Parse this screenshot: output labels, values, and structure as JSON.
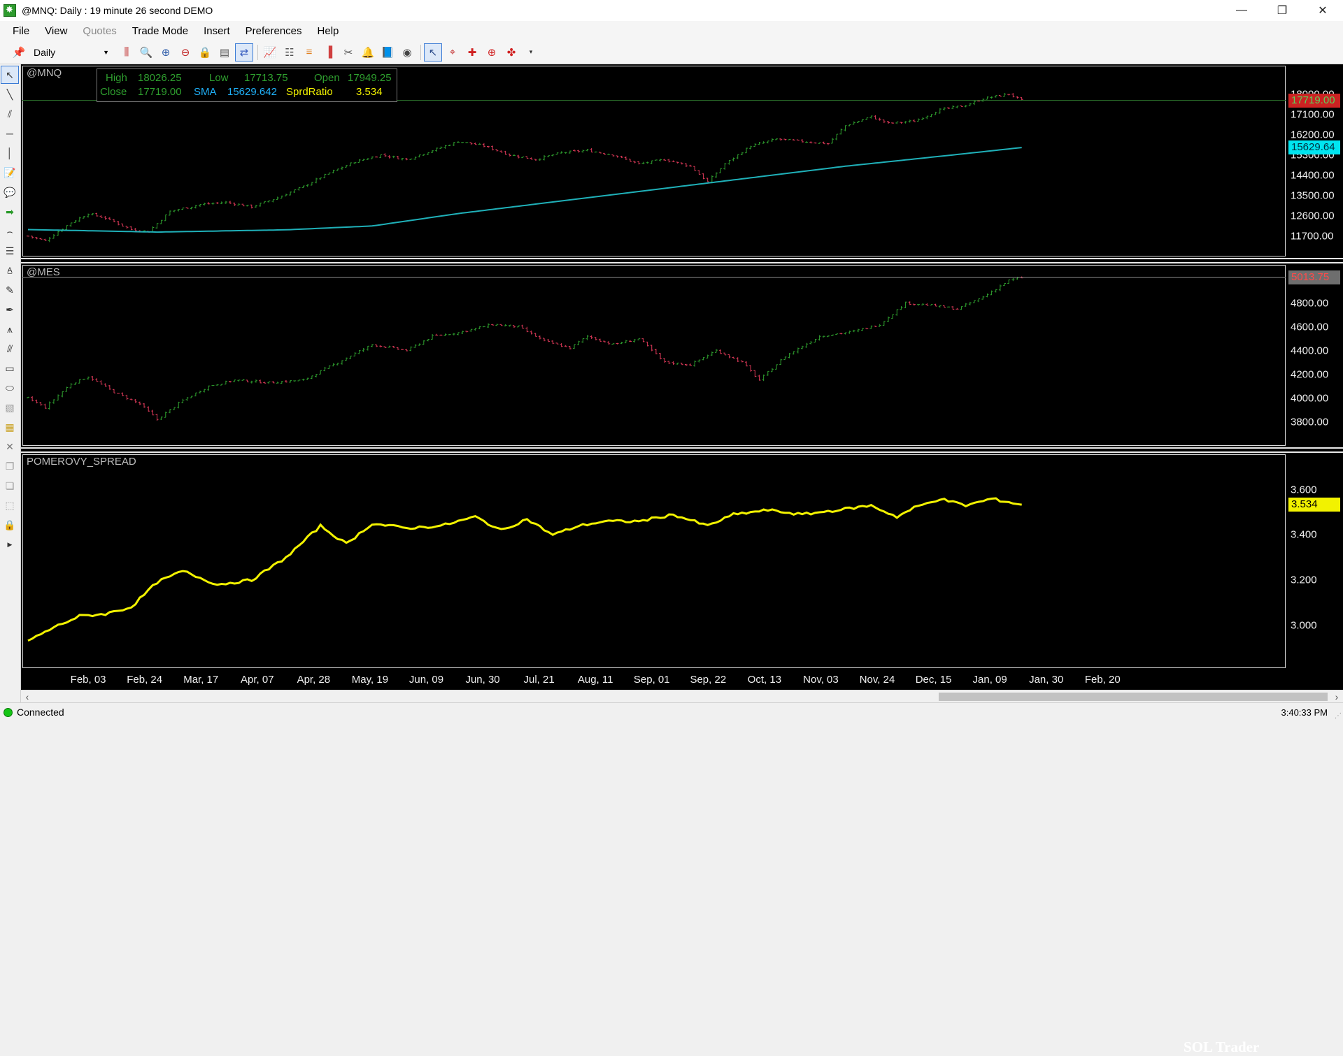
{
  "window": {
    "title": "@MNQ: Daily : 19 minute 26 second DEMO",
    "minimize_icon": "minimize-icon",
    "restore_icon": "restore-icon",
    "close_icon": "close-icon"
  },
  "menu": {
    "file": "File",
    "view": "View",
    "quotes": "Quotes",
    "trade_mode": "Trade Mode",
    "insert": "Insert",
    "preferences": "Preferences",
    "help": "Help"
  },
  "toolbar": {
    "interval": "Daily",
    "icons": [
      "pushpin-icon",
      "bar-style-icon",
      "zoom-menu-icon",
      "zoom-in-icon",
      "zoom-out-icon",
      "lock-icon",
      "page-icon",
      "link-icon",
      "indicator-icon",
      "tree-icon",
      "color-bars-icon",
      "volume-bars-icon",
      "scissors-icon",
      "alert-bell-icon",
      "book-icon",
      "eye-icon",
      "pointer-icon",
      "crosshair-icon",
      "cross-icon",
      "target-icon",
      "overflow-icon"
    ]
  },
  "lefttools": [
    "pointer-icon",
    "line-icon",
    "parallel-lines-icon",
    "horizontal-line-icon",
    "vertical-line-icon",
    "note-icon",
    "callout-icon",
    "arrow-icon",
    "arc-icon",
    "fibonacci-icon",
    "text-icon",
    "pencil-icon",
    "pen-icon",
    "pitchfork-icon",
    "gann-icon",
    "rectangle-icon",
    "ellipse-icon",
    "eraser-icon",
    "calendar-icon",
    "delete-icon",
    "copy-icon",
    "paste-icon",
    "select-icon",
    "padlock-icon",
    "expand-icon"
  ],
  "infobox": {
    "high_label": "High",
    "high_value": "18026.25",
    "low_label": "Low",
    "low_value": "17713.75",
    "open_label": "Open",
    "open_value": "17949.25",
    "close_label": "Close",
    "close_value": "17719.00",
    "sma_label": "SMA",
    "sma_value": "15629.642",
    "ratio_label": "SprdRatio",
    "ratio_value": "3.534"
  },
  "colors": {
    "up_bar": "#2fa02f",
    "down_bar": "#e03a5a",
    "sma_line": "#1fb0b8",
    "spread_line": "#f2f200",
    "last_price_mnq": "#cc2222",
    "last_price_mes": "#ff4a4a",
    "sma_tag_bg": "#00e5f0"
  },
  "chart_data": [
    {
      "type": "candlestick",
      "title": "@MNQ",
      "y_ticks": [
        "18000.00",
        "17100.00",
        "16200.00",
        "15300.00",
        "14400.00",
        "13500.00",
        "12600.00",
        "11700.00"
      ],
      "ylim": [
        11200,
        18700
      ],
      "last_price": 17719.0,
      "last_price_label": "17719.00",
      "sma_value": 15629.64,
      "sma_label": "15629.64",
      "close_path": [
        [
          0,
          11700
        ],
        [
          4,
          11500
        ],
        [
          10,
          12300
        ],
        [
          14,
          12700
        ],
        [
          18,
          12500
        ],
        [
          24,
          12000
        ],
        [
          28,
          11900
        ],
        [
          33,
          12800
        ],
        [
          40,
          13100
        ],
        [
          46,
          13200
        ],
        [
          52,
          13000
        ],
        [
          58,
          13400
        ],
        [
          64,
          13900
        ],
        [
          70,
          14500
        ],
        [
          76,
          15000
        ],
        [
          82,
          15300
        ],
        [
          88,
          15100
        ],
        [
          94,
          15500
        ],
        [
          100,
          15900
        ],
        [
          106,
          15700
        ],
        [
          112,
          15300
        ],
        [
          118,
          15100
        ],
        [
          124,
          15400
        ],
        [
          130,
          15500
        ],
        [
          136,
          15300
        ],
        [
          142,
          14900
        ],
        [
          148,
          15100
        ],
        [
          154,
          14800
        ],
        [
          158,
          14100
        ],
        [
          162,
          14900
        ],
        [
          168,
          15700
        ],
        [
          174,
          16000
        ],
        [
          180,
          15900
        ],
        [
          186,
          15800
        ],
        [
          190,
          16600
        ],
        [
          196,
          17000
        ],
        [
          200,
          16700
        ],
        [
          206,
          16800
        ],
        [
          212,
          17300
        ],
        [
          218,
          17500
        ],
        [
          222,
          17800
        ],
        [
          228,
          18000
        ],
        [
          231,
          17719
        ]
      ],
      "sma_path": [
        [
          0,
          11990
        ],
        [
          30,
          11880
        ],
        [
          60,
          11980
        ],
        [
          80,
          12150
        ],
        [
          100,
          12700
        ],
        [
          130,
          13400
        ],
        [
          160,
          14100
        ],
        [
          190,
          14800
        ],
        [
          215,
          15300
        ],
        [
          231,
          15629.64
        ]
      ]
    },
    {
      "type": "candlestick",
      "title": "@MES",
      "y_ticks": [
        "4800.00",
        "4600.00",
        "4400.00",
        "4200.00",
        "4000.00",
        "3800.00"
      ],
      "ylim": [
        3650,
        5050
      ],
      "last_price": 5013.75,
      "last_price_label": "5013.75",
      "close_path": [
        [
          0,
          4000
        ],
        [
          4,
          3920
        ],
        [
          10,
          4120
        ],
        [
          14,
          4180
        ],
        [
          20,
          4050
        ],
        [
          26,
          3950
        ],
        [
          30,
          3820
        ],
        [
          36,
          3980
        ],
        [
          42,
          4100
        ],
        [
          48,
          4150
        ],
        [
          56,
          4130
        ],
        [
          64,
          4150
        ],
        [
          72,
          4300
        ],
        [
          80,
          4450
        ],
        [
          88,
          4400
        ],
        [
          94,
          4520
        ],
        [
          100,
          4550
        ],
        [
          108,
          4620
        ],
        [
          114,
          4600
        ],
        [
          120,
          4480
        ],
        [
          126,
          4420
        ],
        [
          130,
          4520
        ],
        [
          136,
          4450
        ],
        [
          142,
          4500
        ],
        [
          148,
          4300
        ],
        [
          154,
          4280
        ],
        [
          160,
          4400
        ],
        [
          166,
          4300
        ],
        [
          170,
          4150
        ],
        [
          176,
          4350
        ],
        [
          184,
          4520
        ],
        [
          192,
          4560
        ],
        [
          198,
          4620
        ],
        [
          204,
          4800
        ],
        [
          210,
          4780
        ],
        [
          216,
          4750
        ],
        [
          222,
          4850
        ],
        [
          228,
          4990
        ],
        [
          231,
          5013.75
        ]
      ]
    },
    {
      "type": "line",
      "title": "POMEROVY_SPREAD",
      "y_ticks": [
        "3.600",
        "3.400",
        "3.200",
        "3.000"
      ],
      "ylim": [
        2.85,
        3.72
      ],
      "last_value": 3.534,
      "last_value_label": "3.534",
      "path": [
        [
          0,
          2.93
        ],
        [
          6,
          2.99
        ],
        [
          12,
          3.04
        ],
        [
          18,
          3.05
        ],
        [
          24,
          3.08
        ],
        [
          30,
          3.19
        ],
        [
          36,
          3.24
        ],
        [
          44,
          3.18
        ],
        [
          52,
          3.2
        ],
        [
          60,
          3.3
        ],
        [
          68,
          3.44
        ],
        [
          74,
          3.36
        ],
        [
          80,
          3.45
        ],
        [
          88,
          3.43
        ],
        [
          96,
          3.44
        ],
        [
          104,
          3.48
        ],
        [
          110,
          3.42
        ],
        [
          116,
          3.47
        ],
        [
          122,
          3.4
        ],
        [
          128,
          3.44
        ],
        [
          134,
          3.46
        ],
        [
          142,
          3.46
        ],
        [
          150,
          3.49
        ],
        [
          158,
          3.44
        ],
        [
          164,
          3.49
        ],
        [
          172,
          3.51
        ],
        [
          180,
          3.49
        ],
        [
          188,
          3.51
        ],
        [
          196,
          3.53
        ],
        [
          202,
          3.48
        ],
        [
          206,
          3.52
        ],
        [
          212,
          3.56
        ],
        [
          218,
          3.53
        ],
        [
          224,
          3.56
        ],
        [
          231,
          3.534
        ]
      ]
    }
  ],
  "x_axis": {
    "dates": [
      "Feb, 03",
      "Feb, 24",
      "Mar, 17",
      "Apr, 07",
      "Apr, 28",
      "May, 19",
      "Jun, 09",
      "Jun, 30",
      "Jul, 21",
      "Aug, 11",
      "Sep, 01",
      "Sep, 22",
      "Oct, 13",
      "Nov, 03",
      "Nov, 24",
      "Dec, 15",
      "Jan, 09",
      "Jan, 30",
      "Feb, 20"
    ]
  },
  "watermark": "SOL Trader",
  "status": {
    "connection": "Connected",
    "time": "3:40:33 PM"
  }
}
